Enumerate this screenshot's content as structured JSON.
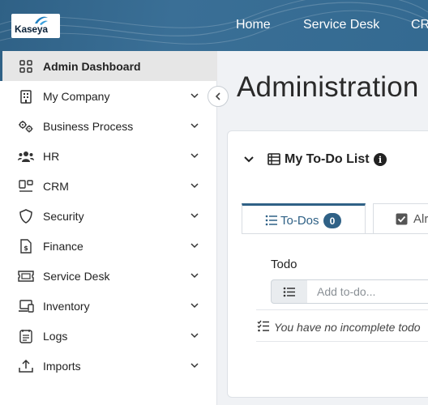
{
  "brand": {
    "logo_text": "Kaseya",
    "accent": "#2f6186"
  },
  "topnav": {
    "items": [
      "Home",
      "Service Desk",
      "CR"
    ]
  },
  "sidebar": {
    "items": [
      {
        "label": "Admin Dashboard",
        "icon": "dashboard-grid-icon",
        "active": true
      },
      {
        "label": "My Company",
        "icon": "building-icon"
      },
      {
        "label": "Business Process",
        "icon": "gears-icon"
      },
      {
        "label": "HR",
        "icon": "people-icon"
      },
      {
        "label": "CRM",
        "icon": "crm-icon"
      },
      {
        "label": "Security",
        "icon": "shield-icon"
      },
      {
        "label": "Finance",
        "icon": "finance-document-icon"
      },
      {
        "label": "Service Desk",
        "icon": "ticket-icon"
      },
      {
        "label": "Inventory",
        "icon": "devices-icon"
      },
      {
        "label": "Logs",
        "icon": "logs-icon"
      },
      {
        "label": "Imports",
        "icon": "upload-icon"
      }
    ]
  },
  "page": {
    "title": "Administration"
  },
  "card": {
    "title": "My To-Do List",
    "tabs": [
      {
        "label": "To-Dos",
        "count": "0",
        "active": true
      },
      {
        "label": "Alr",
        "active": false
      }
    ],
    "todo_label": "Todo",
    "input_placeholder": "Add to-do...",
    "empty_text": "You have no incomplete todo"
  }
}
